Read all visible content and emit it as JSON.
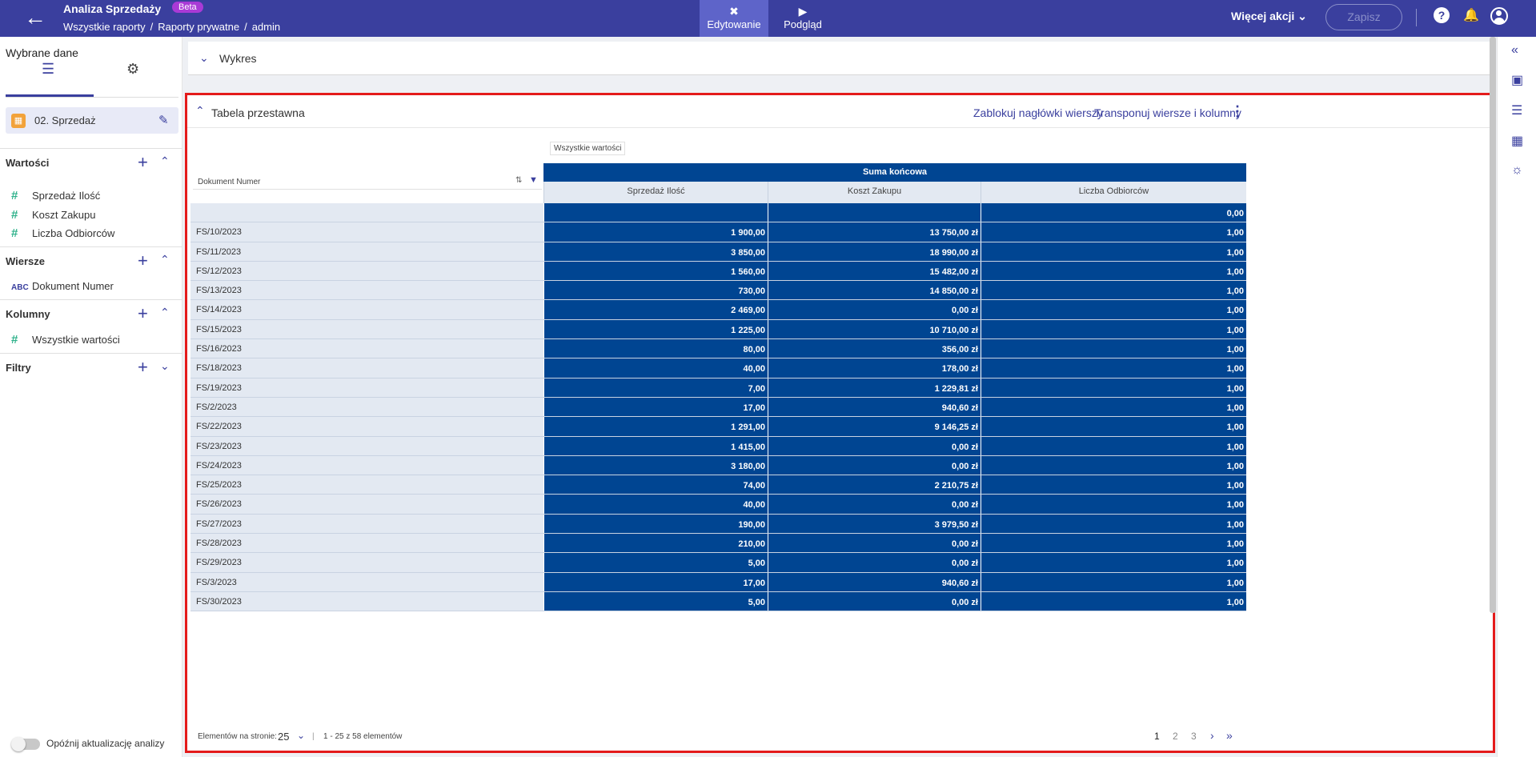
{
  "header": {
    "app_title": "Analiza Sprzedaży",
    "badge": "Beta",
    "breadcrumb": [
      "Wszystkie raporty",
      "Raporty prywatne",
      "admin"
    ],
    "mode_edit": "Edytowanie",
    "mode_view": "Podgląd",
    "more_actions": "Więcej akcji",
    "save": "Zapisz"
  },
  "sidebar": {
    "title": "Wybrane dane",
    "source": "02. Sprzedaż",
    "values_section": "Wartości",
    "values": [
      "Sprzedaż Ilość",
      "Koszt Zakupu",
      "Liczba Odbiorców"
    ],
    "rows_section": "Wiersze",
    "rows": [
      "Dokument Numer"
    ],
    "columns_section": "Kolumny",
    "columns": [
      "Wszystkie wartości"
    ],
    "filters_section": "Filtry",
    "delay_toggle": "Opóźnij aktualizację analizy"
  },
  "chart_panel": {
    "title": "Wykres"
  },
  "pivot": {
    "title": "Tabela przestawna",
    "lock_headers": "Zablokuj nagłówki wierszy",
    "transpose": "Transponuj wiersze i kolumny",
    "column_field": "Wszystkie wartości",
    "row_field": "Dokument Numer",
    "grand_total": "Suma końcowa",
    "columns": [
      "Sprzedaż Ilość",
      "Koszt Zakupu",
      "Liczba Odbiorców"
    ],
    "rows": [
      {
        "label": "",
        "values": [
          "",
          "",
          "0,00"
        ]
      },
      {
        "label": "FS/10/2023",
        "values": [
          "1 900,00",
          "13 750,00 zł",
          "1,00"
        ]
      },
      {
        "label": "FS/11/2023",
        "values": [
          "3 850,00",
          "18 990,00 zł",
          "1,00"
        ]
      },
      {
        "label": "FS/12/2023",
        "values": [
          "1 560,00",
          "15 482,00 zł",
          "1,00"
        ]
      },
      {
        "label": "FS/13/2023",
        "values": [
          "730,00",
          "14 850,00 zł",
          "1,00"
        ]
      },
      {
        "label": "FS/14/2023",
        "values": [
          "2 469,00",
          "0,00 zł",
          "1,00"
        ]
      },
      {
        "label": "FS/15/2023",
        "values": [
          "1 225,00",
          "10 710,00 zł",
          "1,00"
        ]
      },
      {
        "label": "FS/16/2023",
        "values": [
          "80,00",
          "356,00 zł",
          "1,00"
        ]
      },
      {
        "label": "FS/18/2023",
        "values": [
          "40,00",
          "178,00 zł",
          "1,00"
        ]
      },
      {
        "label": "FS/19/2023",
        "values": [
          "7,00",
          "1 229,81 zł",
          "1,00"
        ]
      },
      {
        "label": "FS/2/2023",
        "values": [
          "17,00",
          "940,60 zł",
          "1,00"
        ]
      },
      {
        "label": "FS/22/2023",
        "values": [
          "1 291,00",
          "9 146,25 zł",
          "1,00"
        ]
      },
      {
        "label": "FS/23/2023",
        "values": [
          "1 415,00",
          "0,00 zł",
          "1,00"
        ]
      },
      {
        "label": "FS/24/2023",
        "values": [
          "3 180,00",
          "0,00 zł",
          "1,00"
        ]
      },
      {
        "label": "FS/25/2023",
        "values": [
          "74,00",
          "2 210,75 zł",
          "1,00"
        ]
      },
      {
        "label": "FS/26/2023",
        "values": [
          "40,00",
          "0,00 zł",
          "1,00"
        ]
      },
      {
        "label": "FS/27/2023",
        "values": [
          "190,00",
          "3 979,50 zł",
          "1,00"
        ]
      },
      {
        "label": "FS/28/2023",
        "values": [
          "210,00",
          "0,00 zł",
          "1,00"
        ]
      },
      {
        "label": "FS/29/2023",
        "values": [
          "5,00",
          "0,00 zł",
          "1,00"
        ]
      },
      {
        "label": "FS/3/2023",
        "values": [
          "17,00",
          "940,60 zł",
          "1,00"
        ]
      },
      {
        "label": "FS/30/2023",
        "values": [
          "5,00",
          "0,00 zł",
          "1,00"
        ]
      }
    ]
  },
  "pager": {
    "label": "Elementów na stronie:",
    "page_size": "25",
    "range": "1 - 25 z 58 elementów",
    "pages": [
      "1",
      "2",
      "3"
    ]
  },
  "colors": {
    "topbar": "#3a3f9e",
    "accent": "#3a3f9e",
    "cell": "#004592",
    "highlight": "#e41b1b",
    "beta": "#a93ad6"
  },
  "icons": [
    "back-arrow-icon",
    "edit-tools-icon",
    "play-icon",
    "chevron-down-icon",
    "help-icon",
    "bell-icon",
    "user-icon",
    "layers-icon",
    "gear-icon",
    "pencil-icon",
    "plus-icon",
    "hash-icon",
    "sort-icon",
    "filter-icon",
    "kebab-menu-icon",
    "double-chevron-left-icon",
    "panel-icon",
    "list-icon",
    "layout-icon",
    "palette-icon"
  ]
}
